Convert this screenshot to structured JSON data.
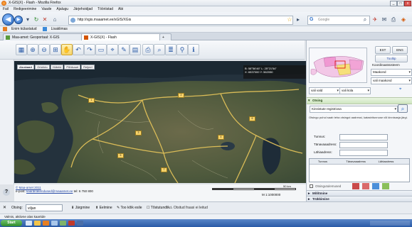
{
  "window": {
    "title": "X-GIS(X) - Flash - Mozilla Firefox",
    "controls": [
      "_",
      "□",
      "x"
    ]
  },
  "menu": [
    "Fail",
    "Redigeerimine",
    "Vaade",
    "Ajalugu",
    "Järjehoidjad",
    "Tööriistad",
    "Abi"
  ],
  "nav": {
    "url": "http://xgis.maaamet.ee/xGIS/XGis",
    "search_placeholder": "Google"
  },
  "bookmarks": [
    "Enim külastatud",
    "Lisaklimas"
  ],
  "tabs": [
    {
      "label": "Maa-amet: Geoportaal: X-GIS",
      "active": false
    },
    {
      "label": "X-GIS(X) - Flash",
      "active": true
    }
  ],
  "map": {
    "tabs": [
      "Aluskaart",
      "Ortofoto",
      "Hübriid",
      "Põhikaart",
      "Reljeef"
    ],
    "coords": {
      "line1": "B: 58°56'46\"  L: 25°21'54\"",
      "line2": "X: 6537000  Y: 562050"
    },
    "scale_text": "M 1:1000000",
    "scale_bar": "50 km"
  },
  "footer": {
    "copyright": "© Maa-amet 2011",
    "email_label": "e-post:",
    "email": "kaardirakendused@maaamet.ee",
    "phone": "tel: 6 750 800"
  },
  "right": {
    "buttons": {
      "est": "EST",
      "eng": "ENG",
      "tooltip": "Tooltip"
    },
    "koordinaadid_label": "Koordinaatsüsteem",
    "select_system": "Maakond",
    "select_layer": "vali maakond",
    "select_row1": "vali vald",
    "select_row2": "vali küla",
    "otsing_header": "Otsing",
    "otsing_select": "Kinnistute registriosa",
    "otsing_text": "Otsingu puhul saab teha otsingut aadressi, katastritunnuse või kinnisasja järgi.",
    "fields": [
      "Tunnus:",
      "Tänavaaadress:",
      "Lähiaadress:"
    ],
    "table_headers": [
      "Tunnus",
      "Tänavaaadress",
      "Lähiaadress"
    ],
    "legend_label": "Otsingutulemused",
    "section2": "Mõõtmine",
    "section3": "Trükkimine"
  },
  "status": {
    "find_label": "Otsing:",
    "find_value": "viljan",
    "options": [
      "Järgmine",
      "Eelmine",
      "Too kõik esile",
      "Tõstutundlik"
    ],
    "notice": "Otsitud fraasi ei leitud"
  },
  "status2": "Valmis, aktiivne alas kaartide",
  "taskbar": {
    "start": "Start"
  },
  "colors": {
    "accent": "#2c6fc9",
    "header_green": "#cfe6c0",
    "map_bg": "#2a3a46"
  }
}
